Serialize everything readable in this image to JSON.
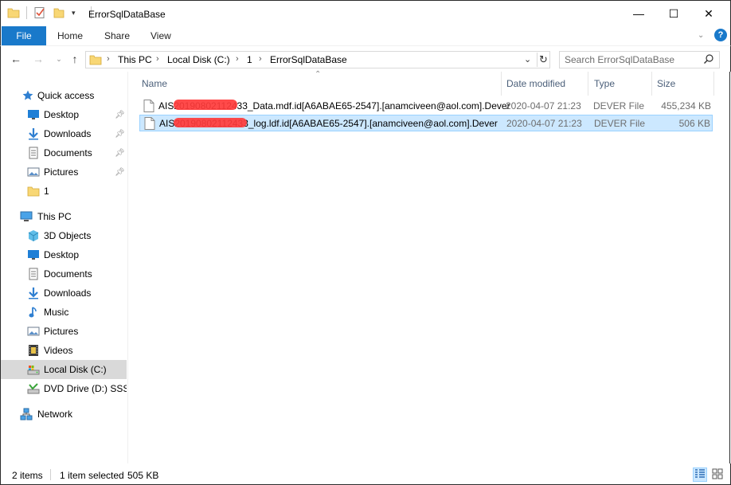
{
  "window": {
    "title": "ErrorSqlDataBase",
    "minimize_glyph": "—",
    "maximize_glyph": "☐",
    "close_glyph": "✕"
  },
  "ribbon": {
    "tabs": [
      "File",
      "Home",
      "Share",
      "View"
    ]
  },
  "address": {
    "crumbs": [
      "This PC",
      "Local Disk (C:)",
      "1",
      "ErrorSqlDataBase"
    ]
  },
  "search": {
    "placeholder": "Search ErrorSqlDataBase"
  },
  "nav": {
    "quick_access": {
      "label": "Quick access",
      "items": [
        {
          "label": "Desktop",
          "icon": "desktop-icon",
          "pinned": true
        },
        {
          "label": "Downloads",
          "icon": "download-icon",
          "pinned": true
        },
        {
          "label": "Documents",
          "icon": "documents-icon",
          "pinned": true
        },
        {
          "label": "Pictures",
          "icon": "pictures-icon",
          "pinned": true
        },
        {
          "label": "1",
          "icon": "folder-icon",
          "pinned": false
        }
      ]
    },
    "this_pc": {
      "label": "This PC",
      "items": [
        {
          "label": "3D Objects",
          "icon": "3d-objects-icon"
        },
        {
          "label": "Desktop",
          "icon": "desktop-icon"
        },
        {
          "label": "Documents",
          "icon": "documents-icon"
        },
        {
          "label": "Downloads",
          "icon": "download-icon"
        },
        {
          "label": "Music",
          "icon": "music-icon"
        },
        {
          "label": "Pictures",
          "icon": "pictures-icon"
        },
        {
          "label": "Videos",
          "icon": "videos-icon"
        },
        {
          "label": "Local Disk (C:)",
          "icon": "local-disk-icon",
          "selected": true
        },
        {
          "label": "DVD Drive (D:) SSS_X",
          "icon": "dvd-drive-icon"
        }
      ]
    },
    "network": {
      "label": "Network"
    }
  },
  "columns": {
    "name": "Name",
    "date": "Date modified",
    "type": "Type",
    "size": "Size"
  },
  "files": [
    {
      "name": "AIS20190802112433_Data.mdf.id[A6ABAE65-2547].[anamciveen@aol.com].Dever",
      "date": "2020-04-07 21:23",
      "type": "DEVER File",
      "size": "455,234 KB",
      "selected": false
    },
    {
      "name": "AIS20190802112433_log.ldf.id[A6ABAE65-2547].[anamciveen@aol.com].Dever",
      "date": "2020-04-07 21:23",
      "type": "DEVER File",
      "size": "506 KB",
      "selected": true
    }
  ],
  "status": {
    "items_count": "2 items",
    "selection": "1 item selected",
    "selection_size": "505 KB"
  },
  "colors": {
    "accent": "#1979ca",
    "selection_bg": "#cce8ff",
    "selection_border": "#99d1ff",
    "redaction": "#ff3b3b"
  }
}
